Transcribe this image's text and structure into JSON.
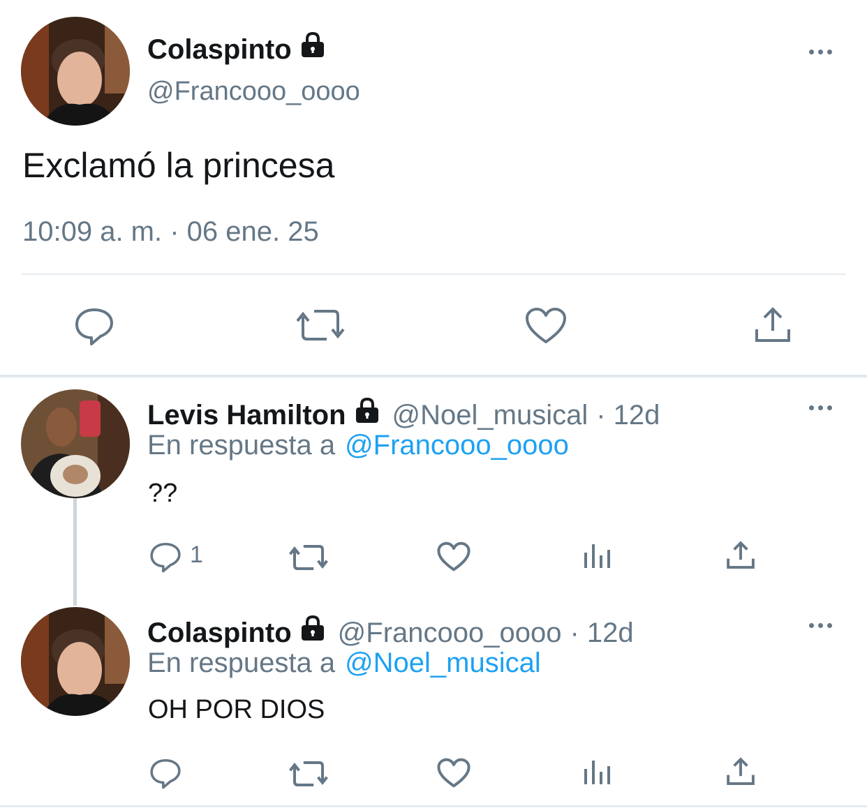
{
  "main_tweet": {
    "author_name": "Colaspinto",
    "author_handle": "@Francooo_oooo",
    "text": "Exclamó la princesa",
    "timestamp": "10:09 a. m. · 06 ene. 25",
    "protected": true
  },
  "replies": [
    {
      "author_name": "Levis Hamilton",
      "author_handle": "@Noel_musical",
      "age": "· 12d",
      "reply_prefix": "En respuesta a",
      "reply_to": "@Francooo_oooo",
      "text": "??",
      "reply_count": "1",
      "protected": true
    },
    {
      "author_name": "Colaspinto",
      "author_handle": "@Francooo_oooo",
      "age": "· 12d",
      "reply_prefix": "En respuesta a",
      "reply_to": "@Noel_musical",
      "text": "OH POR DIOS",
      "reply_count": "",
      "protected": true
    }
  ],
  "colors": {
    "text": "#14171a",
    "muted": "#657786",
    "link": "#1da1f2",
    "divider": "#e6ecf0"
  },
  "icons": [
    "lock-icon",
    "more-icon",
    "reply-icon",
    "retweet-icon",
    "like-icon",
    "share-icon",
    "analytics-icon"
  ]
}
